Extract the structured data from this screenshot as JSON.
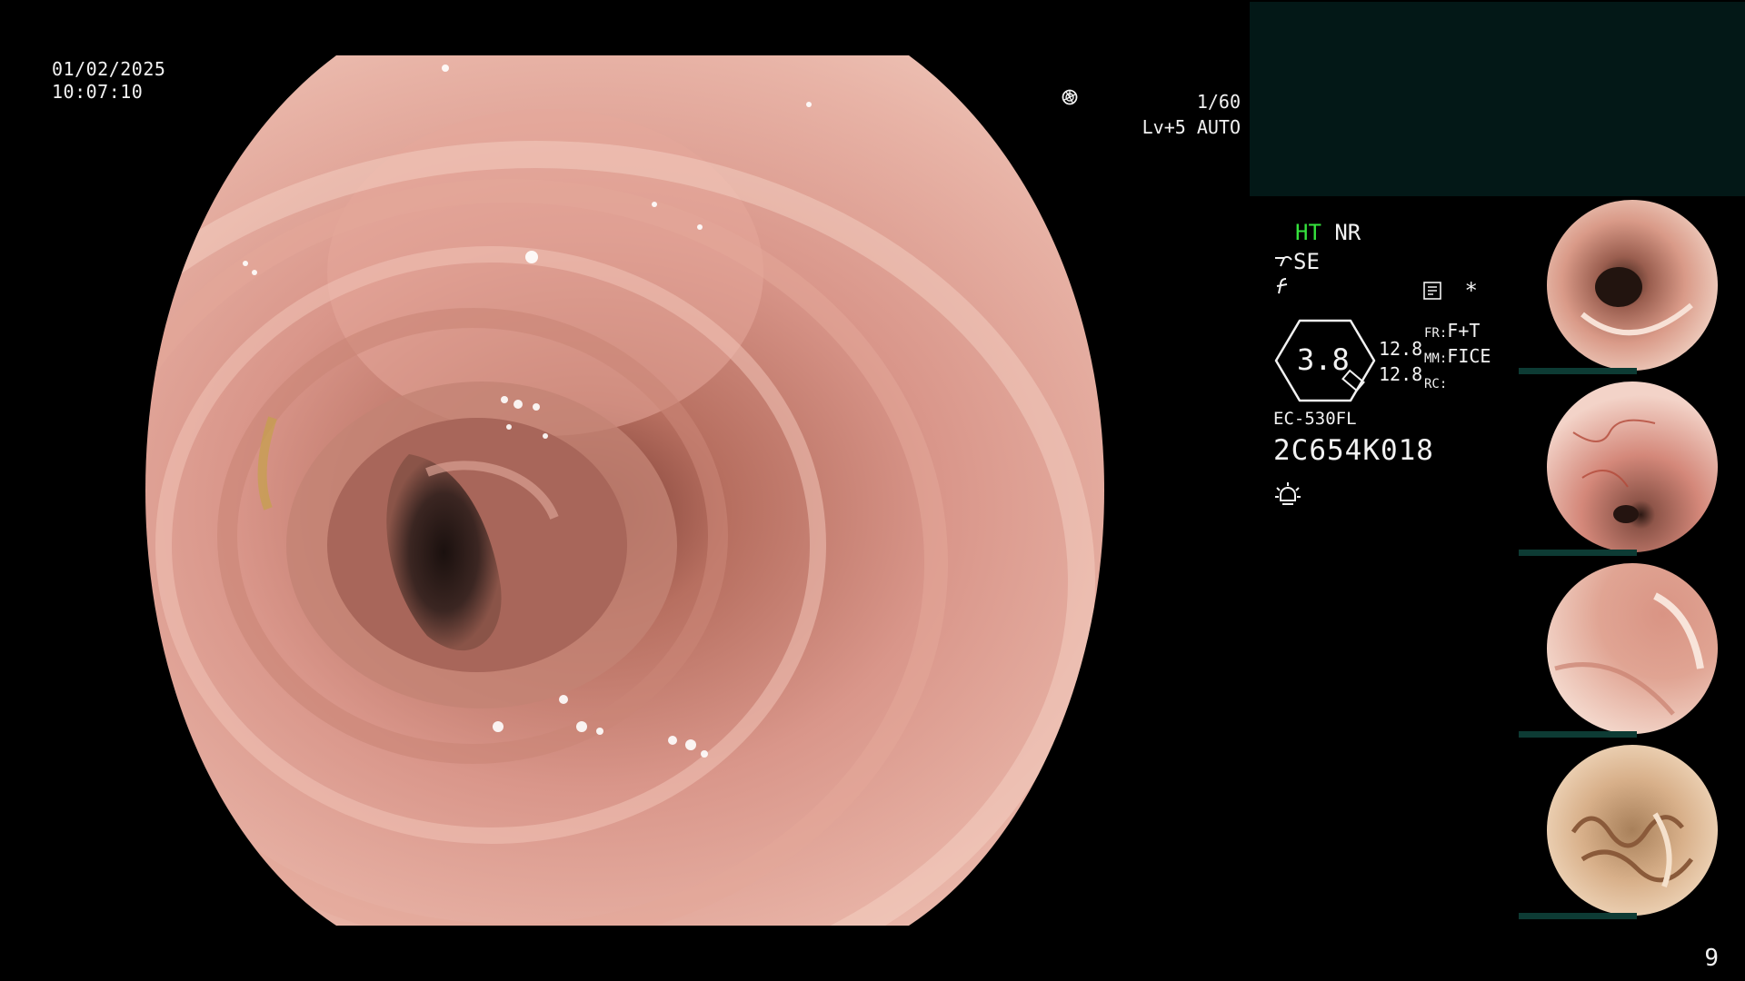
{
  "overlay": {
    "date": "01/02/2025",
    "time": "10:07:10",
    "shutter": "1/60",
    "level": "Lv+5",
    "auto_label": "AUTO"
  },
  "settings": {
    "ht": "HT",
    "nr": "NR",
    "se": "SE",
    "asterisk": "*",
    "gauge_value": "3.8",
    "val_top": "12.8",
    "val_bottom": "12.8",
    "fr_label": "FR:",
    "fr_value": "F+T",
    "mm_label": "MM:",
    "mm_value": "FICE",
    "rc_label": "RC:",
    "scope_model": "EC-530FL",
    "scope_serial": "2C654K018"
  },
  "page_number": "9",
  "colors": {
    "highlight_green": "#35e33d",
    "panel_dark": "#031817",
    "thumb_bar": "#0d3b34",
    "text": "#f2f2f2"
  },
  "icons": [
    "shutter-icon",
    "auto-iris-icon",
    "scope-glyph-icon",
    "function-glyph-icon",
    "memo-icon",
    "light-icon"
  ]
}
